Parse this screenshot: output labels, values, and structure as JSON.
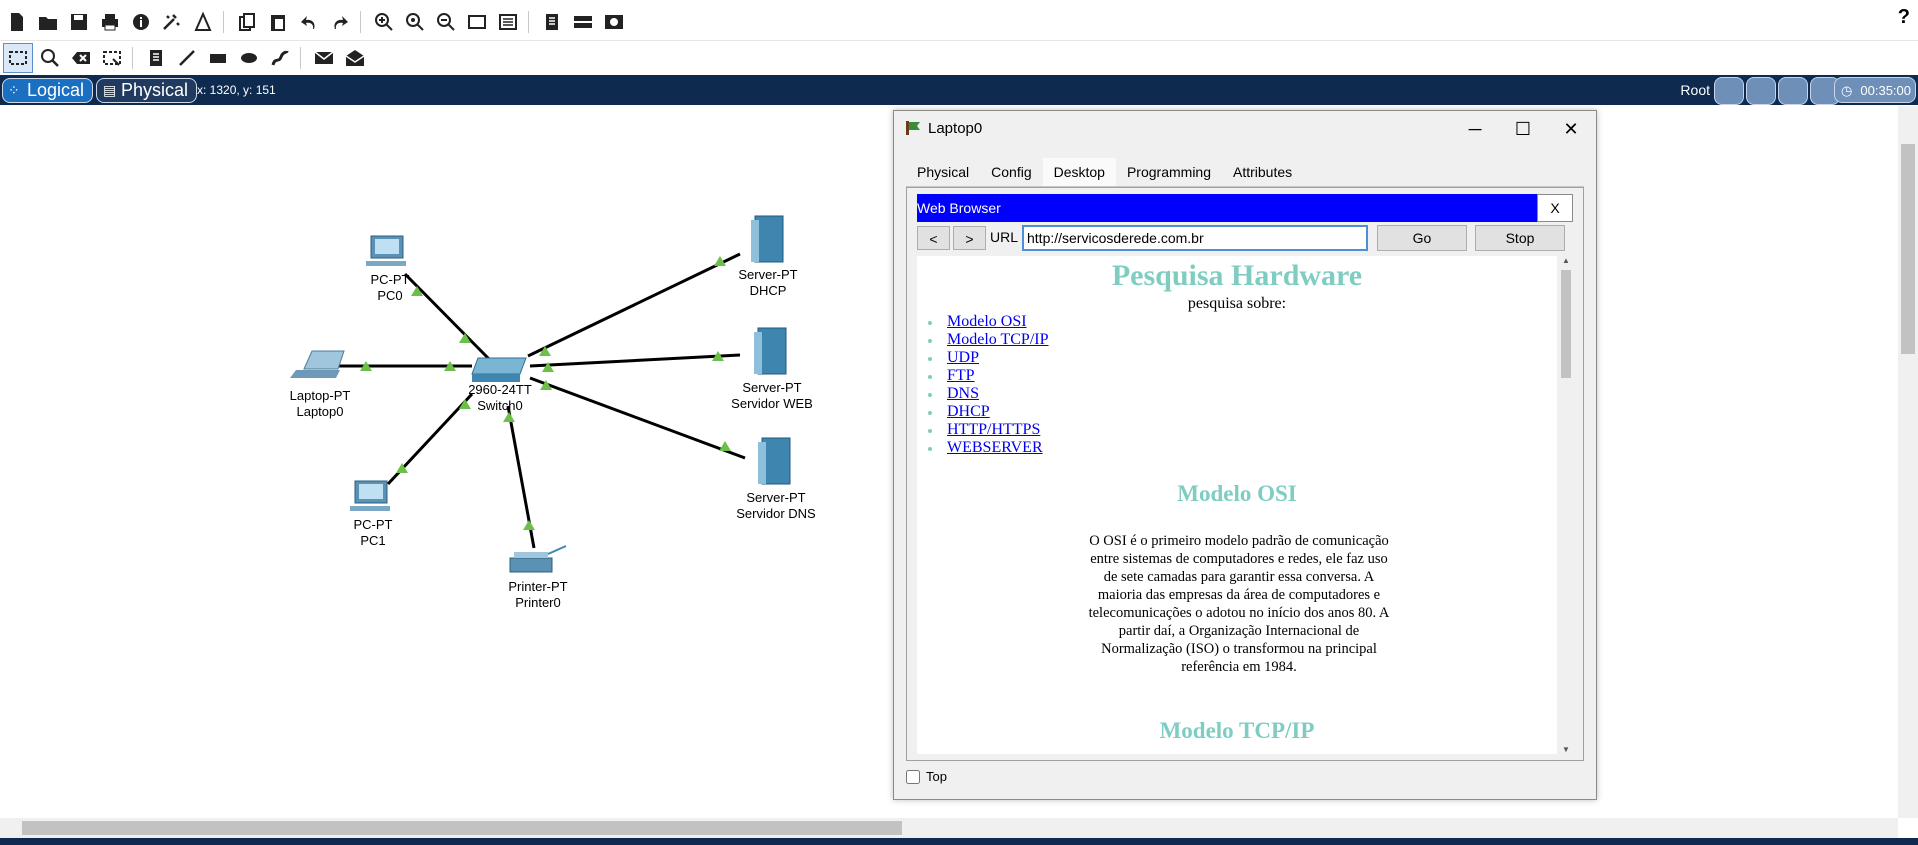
{
  "toolbar": {
    "help_label": "?"
  },
  "workspace_bar": {
    "logical_label": "Logical",
    "physical_label": "Physical",
    "coords": "x: 1320, y: 151",
    "root_label": "Root",
    "clock": "00:35:00"
  },
  "devices": {
    "pc0": {
      "type": "PC-PT",
      "name": "PC0"
    },
    "laptop0": {
      "type": "Laptop-PT",
      "name": "Laptop0"
    },
    "pc1": {
      "type": "PC-PT",
      "name": "PC1"
    },
    "switch0": {
      "type": "2960-24TT",
      "name": "Switch0"
    },
    "printer0": {
      "type": "Printer-PT",
      "name": "Printer0"
    },
    "dhcp": {
      "type": "Server-PT",
      "name": "DHCP"
    },
    "web": {
      "type": "Server-PT",
      "name": "Servidor WEB"
    },
    "dns": {
      "type": "Server-PT",
      "name": "Servidor DNS"
    }
  },
  "colors": {
    "link_up": "#6cc04a",
    "workspace_bar": "#0e2a4e",
    "browser_title": "#0000ff",
    "heading": "#7fcdc2"
  },
  "laptop_window": {
    "title": "Laptop0",
    "minimize": "─",
    "maximize": "☐",
    "close": "✕",
    "tabs": [
      "Physical",
      "Config",
      "Desktop",
      "Programming",
      "Attributes"
    ],
    "active_tab": "Desktop",
    "top_label": "Top",
    "top_checked": false
  },
  "browser": {
    "title": "Web Browser",
    "close_label": "X",
    "back_label": "<",
    "forward_label": ">",
    "url_label": "URL",
    "url_value": "http://servicosderede.com.br",
    "go_label": "Go",
    "stop_label": "Stop"
  },
  "web_page": {
    "title": "Pesquisa Hardware",
    "subtitle": "pesquisa sobre:",
    "links": [
      "Modelo OSI",
      "Modelo TCP/IP",
      "UDP",
      "FTP",
      "DNS",
      "DHCP",
      "HTTP/HTTPS",
      "WEBSERVER"
    ],
    "section1_title": "Modelo OSI",
    "section1_text": "O OSI é o primeiro modelo padrão de comunicação entre sistemas de computadores e redes, ele faz uso de sete camadas para garantir essa conversa. A maioria das empresas da área de computadores e telecomunicações o adotou no início dos anos 80. A partir daí, a Organização Internacional de Normalização (ISO) o transformou na principal referência em 1984.",
    "section2_title": "Modelo TCP/IP"
  }
}
